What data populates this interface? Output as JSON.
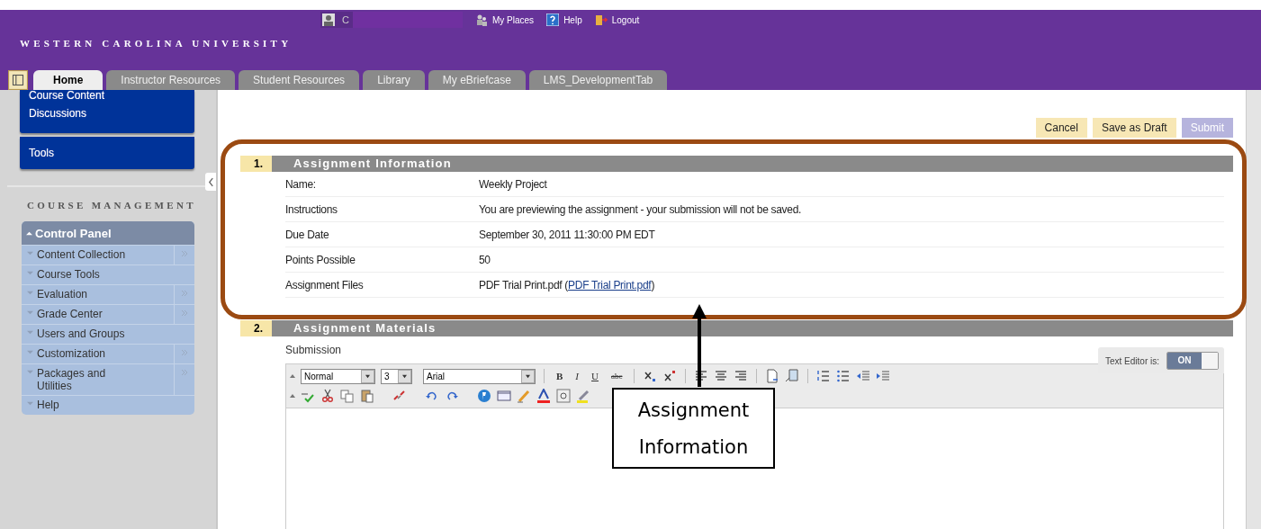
{
  "header": {
    "brand": "WESTERN CAROLINA UNIVERSITY",
    "user_initial": "C",
    "links": [
      {
        "kind": "places",
        "label": "My Places"
      },
      {
        "kind": "help",
        "label": "Help"
      },
      {
        "kind": "logout",
        "label": "Logout"
      }
    ]
  },
  "tabs": [
    {
      "label": "Home",
      "selected": true
    },
    {
      "label": "Instructor Resources",
      "selected": false
    },
    {
      "label": "Student Resources",
      "selected": false
    },
    {
      "label": "Library",
      "selected": false
    },
    {
      "label": "My eBriefcase",
      "selected": false
    },
    {
      "label": "LMS_DevelopmentTab",
      "selected": false
    }
  ],
  "course_menu": {
    "groups": [
      [
        "Course Content",
        "Discussions"
      ],
      [
        "Tools"
      ]
    ]
  },
  "course_management": {
    "heading": "COURSE MANAGEMENT",
    "control_panel": {
      "title": "Control Panel",
      "expanded": true,
      "items": [
        {
          "label": "Content Collection",
          "submenu": true
        },
        {
          "label": "Course Tools",
          "submenu": false
        },
        {
          "label": "Evaluation",
          "submenu": true
        },
        {
          "label": "Grade Center",
          "submenu": true
        },
        {
          "label": "Users and Groups",
          "submenu": false
        },
        {
          "label": "Customization",
          "submenu": true
        },
        {
          "label": "Packages and Utilities",
          "submenu": true
        },
        {
          "label": "Help",
          "submenu": false
        }
      ]
    }
  },
  "actions": [
    {
      "label": "Cancel",
      "disabled": false
    },
    {
      "label": "Save as Draft",
      "disabled": false
    },
    {
      "label": "Submit",
      "disabled": true
    }
  ],
  "assignment_information": {
    "number": "1.",
    "title": "Assignment Information",
    "rows": [
      {
        "label": "Name:",
        "value": "Weekly Project"
      },
      {
        "label": "Instructions",
        "value": "You are previewing the assignment - your submission will not be saved."
      },
      {
        "label": "Due Date",
        "value": "September 30, 2011 11:30:00 PM EDT"
      },
      {
        "label": "Points Possible",
        "value": "50"
      },
      {
        "label": "Assignment Files",
        "value": "PDF Trial Print.pdf (",
        "link": "PDF Trial Print.pdf",
        "after": ")"
      }
    ]
  },
  "assignment_materials": {
    "number": "2.",
    "title": "Assignment Materials",
    "submission_label": "Submission",
    "editor": {
      "toggle_label": "Text Editor is:",
      "toggle": {
        "label": "ON",
        "on": true
      },
      "format": "Normal",
      "size": "3",
      "font": "Arial",
      "text_buttons": [
        "B",
        "I",
        "U",
        "abc"
      ]
    }
  },
  "annotation": {
    "text": "Assignment Information"
  }
}
